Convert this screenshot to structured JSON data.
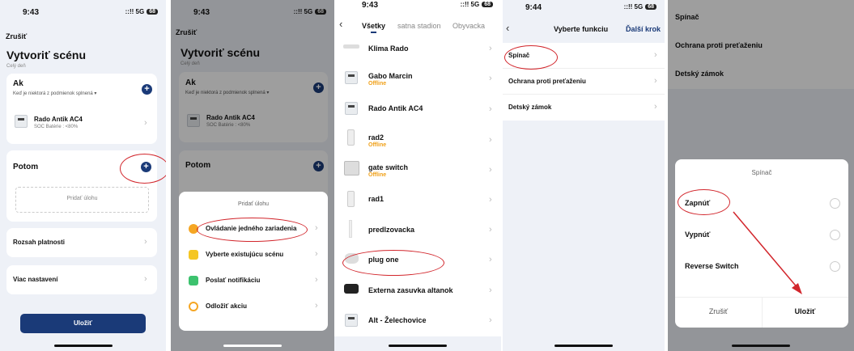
{
  "colors": {
    "accent": "#1a3a78",
    "offline": "#f0a018",
    "annotation": "#d2262c"
  },
  "panel1": {
    "time": "9:43",
    "signal": "::!! 5G",
    "battery": "68",
    "cancel": "Zrušiť",
    "title": "Vytvoriť scénu",
    "subtitle": "Celý deň",
    "if_title": "Ak",
    "if_sub": "Keď je niektorá z podmienok splnená ▾",
    "device_name": "Rado Antik AC4",
    "device_cond": "SOC Batérie : <80%",
    "then_title": "Potom",
    "add_task": "Pridať úlohu",
    "validity": "Rozsah platnosti",
    "more_settings": "Viac nastavení",
    "save": "Uložiť"
  },
  "panel2": {
    "time": "9:43",
    "signal": "::!! 5G",
    "battery": "68",
    "cancel": "Zrušiť",
    "title": "Vytvoriť scénu",
    "subtitle": "Celý deň",
    "if_title": "Ak",
    "if_sub": "Keď je niektorá z podmienok splnená ▾",
    "device_name": "Rado Antik AC4",
    "device_cond": "SOC Batérie : <80%",
    "then_title": "Potom",
    "sheet_title": "Pridať úlohu",
    "options": [
      {
        "label": "Ovládanie jedného zariadenia",
        "icon": "lightbulb-icon",
        "color": "#f5a623"
      },
      {
        "label": "Vyberte existujúcu scénu",
        "icon": "check-square-icon",
        "color": "#f5c623"
      },
      {
        "label": "Poslať notifikáciu",
        "icon": "message-icon",
        "color": "#3cc26e"
      },
      {
        "label": "Odložiť akciu",
        "icon": "clock-icon",
        "color": "#f5a623"
      }
    ]
  },
  "panel3": {
    "time": "9:43",
    "signal": "::!! 5G",
    "battery": "68",
    "tabs": [
      "Všetky",
      "satna stadion",
      "Obyvacka"
    ],
    "devices": [
      {
        "name": "Klima Rado",
        "status": ""
      },
      {
        "name": "Gabo Marcin",
        "status": "Offline"
      },
      {
        "name": "Rado Antik AC4",
        "status": ""
      },
      {
        "name": "rad2",
        "status": "Offline"
      },
      {
        "name": "gate switch",
        "status": "Offline"
      },
      {
        "name": "rad1",
        "status": ""
      },
      {
        "name": "predlzovacka",
        "status": ""
      },
      {
        "name": "plug one",
        "status": ""
      },
      {
        "name": "Externa zasuvka altanok",
        "status": ""
      },
      {
        "name": "Alt - Želechovice",
        "status": ""
      }
    ]
  },
  "panel4": {
    "time": "9:44",
    "signal": "::!! 5G",
    "battery": "68",
    "title": "Vyberte funkciu",
    "next": "Ďalší krok",
    "functions": [
      "Spínač",
      "Ochrana proti preťaženiu",
      "Detský zámok"
    ]
  },
  "panel5": {
    "functions": [
      "Spínač",
      "Ochrana proti preťaženiu",
      "Detský zámok"
    ],
    "dialog_title": "Spínač",
    "options": [
      "Zapnúť",
      "Vypnúť",
      "Reverse Switch"
    ],
    "cancel": "Zrušiť",
    "save": "Uložiť"
  }
}
